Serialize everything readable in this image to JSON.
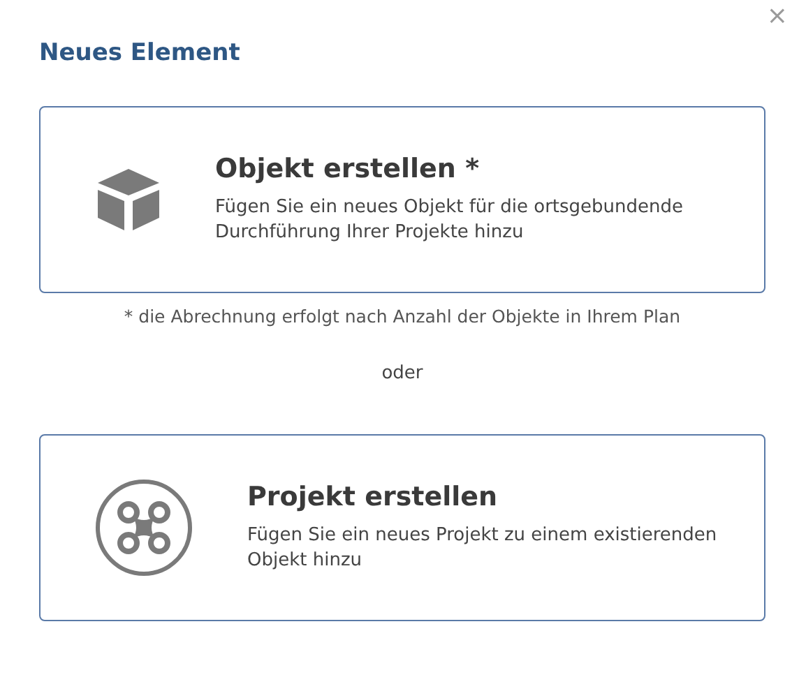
{
  "dialog": {
    "title": "Neues Element",
    "close": "×"
  },
  "options": [
    {
      "kind": "cube",
      "title": "Objekt erstellen *",
      "description": "Fügen Sie ein neues Objekt für die ortsgebundende Durchführung Ihrer Projekte hinzu"
    },
    {
      "kind": "drone",
      "title": "Projekt erstellen",
      "description": "Fügen Sie ein neues Projekt zu einem existierenden Objekt hinzu"
    }
  ],
  "footnote": "* die Abrechnung erfolgt nach Anzahl der Objekte in Ihrem Plan",
  "separator": "oder"
}
